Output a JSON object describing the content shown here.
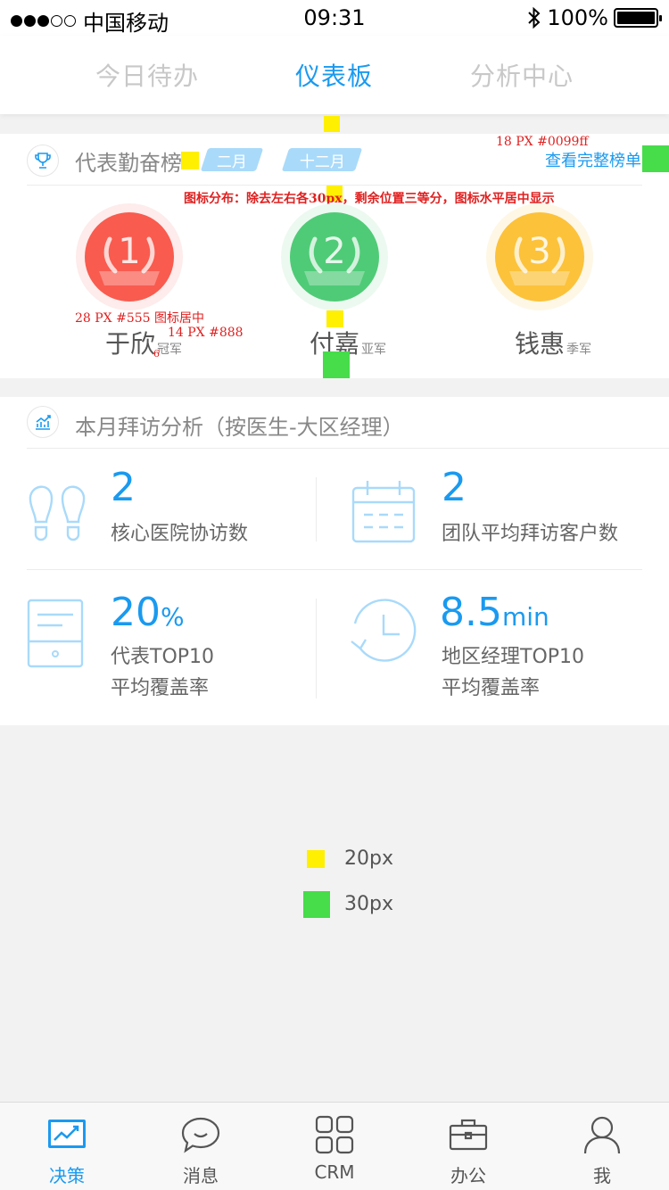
{
  "status_bar": {
    "carrier": "中国移动",
    "time": "09:31",
    "battery": "100%"
  },
  "top_tabs": [
    {
      "label": "今日待办"
    },
    {
      "label": "仪表板",
      "active": true
    },
    {
      "label": "分析中心"
    }
  ],
  "ranking": {
    "title": "代表勤奋榜",
    "period_tabs": [
      "二月",
      "十二月"
    ],
    "view_all": "查看完整榜单",
    "winners": [
      {
        "rank": "1",
        "name": "于欣",
        "title": "冠军",
        "color": "#f95b4f"
      },
      {
        "rank": "2",
        "name": "付嘉",
        "title": "亚军",
        "color": "#4fcb77"
      },
      {
        "rank": "3",
        "name": "钱惠",
        "title": "季军",
        "color": "#fcc23a"
      }
    ]
  },
  "annotations": {
    "link_spec": "18 PX   #0099ff",
    "layout_spec": "图标分布：除去左右各30px，剩余位置三等分，图标水平居中显示",
    "name_spec": "28 PX   #555 图标居中",
    "title_spec": "14 PX   #888",
    "gap_mark": "6"
  },
  "visits": {
    "title": "本月拜访分析（按医生-大区经理）",
    "stats": [
      {
        "value": "2",
        "unit": "",
        "label_lines": [
          "核心医院协访数"
        ],
        "icon": "footprints-icon"
      },
      {
        "value": "2",
        "unit": "",
        "label_lines": [
          "团队平均拜访客户数"
        ],
        "icon": "calendar-icon"
      },
      {
        "value": "20",
        "unit": "%",
        "label_lines": [
          "代表TOP10",
          "平均覆盖率"
        ],
        "icon": "document-icon"
      },
      {
        "value": "8.5",
        "unit": "min",
        "label_lines": [
          "地区经理TOP10",
          "平均覆盖率"
        ],
        "icon": "clock-icon"
      }
    ]
  },
  "legend": {
    "yellow": "20px",
    "green": "30px"
  },
  "bottom_nav": [
    {
      "label": "决策",
      "icon": "chart-icon",
      "active": true
    },
    {
      "label": "消息",
      "icon": "chat-icon"
    },
    {
      "label": "CRM",
      "icon": "grid-icon"
    },
    {
      "label": "办公",
      "icon": "briefcase-icon"
    },
    {
      "label": "我",
      "icon": "person-icon"
    }
  ],
  "colors": {
    "accent": "#1a9af0",
    "pill": "#a9dafa",
    "annotation": "#e02020",
    "spec_yellow": "#ffef00",
    "spec_green": "#46dc4a"
  }
}
